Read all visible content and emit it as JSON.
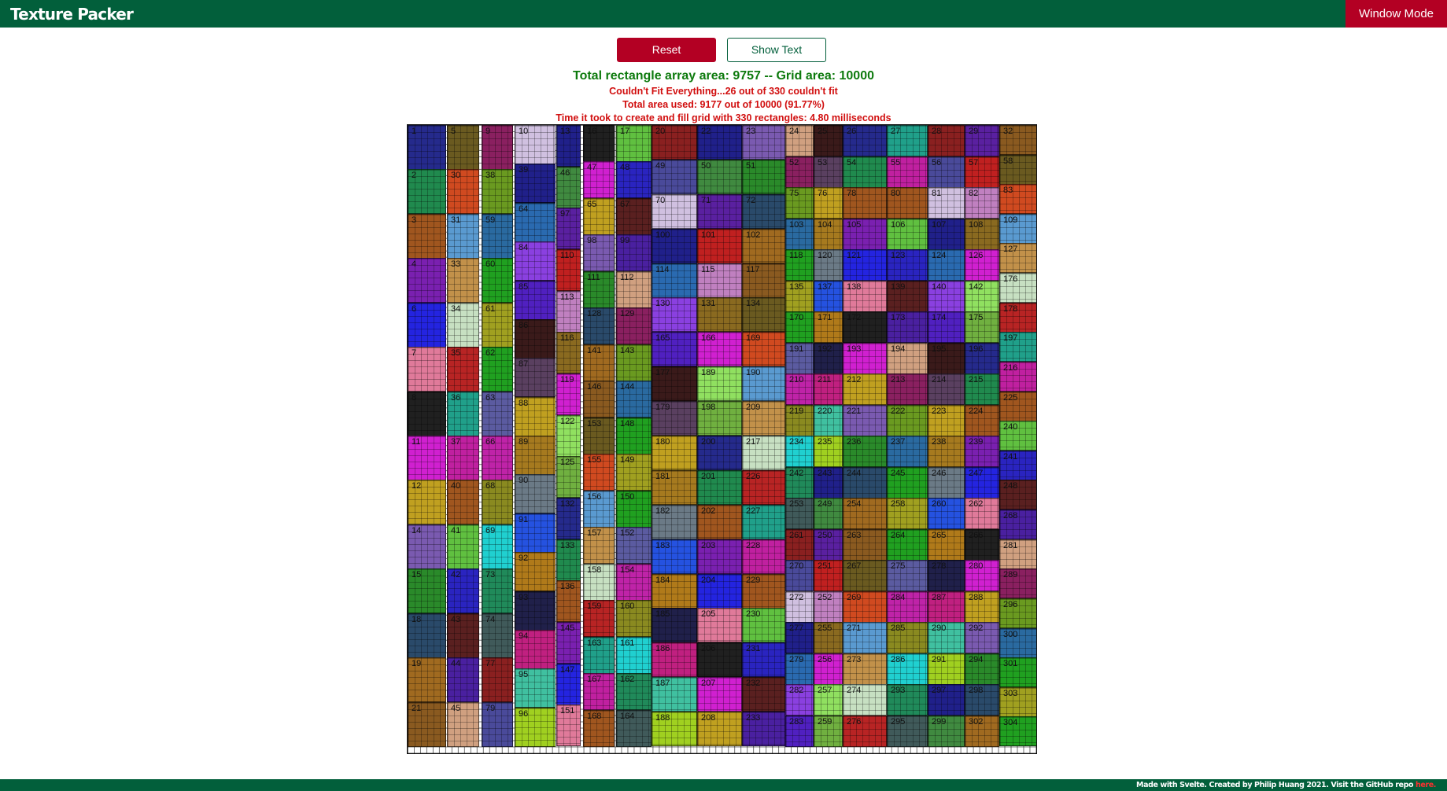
{
  "header": {
    "title": "Texture Packer",
    "window_mode_label": "Window Mode"
  },
  "controls": {
    "reset_label": "Reset",
    "show_text_label": "Show Text"
  },
  "stats": {
    "area_line": "Total rectangle array area: 9757 -- Grid area: 10000",
    "fit_line": "Couldn't Fit Everything...26 out of 330 couldn't fit",
    "used_line": "Total area used: 9177 out of 10000 (91.77%)",
    "time_line": "Time it took to create and fill grid with 330 rectangles: 4.80 milliseconds"
  },
  "grid_columns": [
    [
      "1",
      "2",
      "3",
      "4",
      "6",
      "7",
      "8",
      "11",
      "12",
      "14",
      "15",
      "18",
      "19",
      "21"
    ],
    [
      "5",
      "30",
      "31",
      "33",
      "34",
      "35",
      "36",
      "37",
      "40",
      "41",
      "42",
      "43",
      "44",
      "45"
    ],
    [
      "9",
      "38",
      "59",
      "60",
      "61",
      "62",
      "63",
      "66",
      "68",
      "69",
      "73",
      "74",
      "77",
      "79"
    ],
    [
      "10",
      "39",
      "64",
      "84",
      "85",
      "86",
      "87",
      "88",
      "89",
      "90",
      "91",
      "92",
      "93",
      "94",
      "95",
      "96"
    ],
    [
      "13",
      "46",
      "97",
      "110",
      "113",
      "116",
      "119",
      "122",
      "125",
      "132",
      "133",
      "136",
      "145",
      "147",
      "151"
    ],
    [
      "16",
      "47",
      "65",
      "98",
      "111",
      "128",
      "141",
      "146",
      "153",
      "155",
      "156",
      "157",
      "158",
      "159",
      "163",
      "167",
      "168"
    ],
    [
      "17",
      "48",
      "67",
      "99",
      "112",
      "129",
      "143",
      "144",
      "148",
      "149",
      "150",
      "152",
      "154",
      "160",
      "161",
      "162",
      "164"
    ],
    [
      "20",
      "49",
      "70",
      "100",
      "114",
      "130",
      "165",
      "177",
      "179",
      "180",
      "181",
      "182",
      "183",
      "184",
      "185",
      "186",
      "187",
      "188"
    ],
    [
      "22",
      "50",
      "71",
      "101",
      "115",
      "131",
      "166",
      "189",
      "198",
      "200",
      "201",
      "202",
      "203",
      "204",
      "205",
      "206",
      "207",
      "208"
    ],
    [
      "23",
      "51",
      "72",
      "102",
      "117",
      "134",
      "169",
      "190",
      "209",
      "217",
      "226",
      "227",
      "228",
      "229",
      "230",
      "231",
      "232",
      "233"
    ],
    [
      "24",
      "52",
      "75",
      "103",
      "118",
      "135",
      "170",
      "191",
      "210",
      "219",
      "234",
      "242",
      "253",
      "261",
      "270",
      "272",
      "277",
      "279",
      "282",
      "283"
    ],
    [
      "25",
      "53",
      "76",
      "104",
      "120",
      "137",
      "171",
      "192",
      "211",
      "220",
      "235",
      "243",
      "249",
      "250",
      "251",
      "252",
      "255",
      "256",
      "257",
      "259"
    ],
    [
      "26",
      "54",
      "78",
      "105",
      "121",
      "138",
      "172",
      "193",
      "212",
      "221",
      "236",
      "244",
      "254",
      "263",
      "267",
      "269",
      "271",
      "273",
      "274",
      "276"
    ],
    [
      "27",
      "55",
      "80",
      "106",
      "123",
      "139",
      "173",
      "194",
      "213",
      "222",
      "237",
      "245",
      "258",
      "264",
      "275",
      "284",
      "285",
      "286",
      "293",
      "295"
    ],
    [
      "28",
      "56",
      "81",
      "107",
      "124",
      "140",
      "174",
      "195",
      "214",
      "223",
      "238",
      "246",
      "260",
      "265",
      "278",
      "287",
      "290",
      "291",
      "297",
      "299"
    ],
    [
      "29",
      "57",
      "82",
      "108",
      "126",
      "142",
      "175",
      "196",
      "215",
      "224",
      "239",
      "247",
      "262",
      "266",
      "280",
      "288",
      "292",
      "294",
      "298",
      "302"
    ],
    [
      "32",
      "58",
      "83",
      "109",
      "127",
      "176",
      "178",
      "197",
      "216",
      "225",
      "240",
      "241",
      "248",
      "268",
      "281",
      "289",
      "296",
      "300",
      "301",
      "303",
      "304"
    ]
  ],
  "palette": [
    "#252a8c",
    "#c2914a",
    "#5b5ba0",
    "#a67a1f",
    "#1fcf5c",
    "#e01fb4",
    "#707327",
    "#d65a1f",
    "#9a8fbf",
    "#8a2060",
    "#ea2424",
    "#2f5f2f",
    "#5c1f1f",
    "#2f8a2f",
    "#208a4e",
    "#c7e0c2",
    "#bf23a8",
    "#6b7a86",
    "#9a5a7a",
    "#8a8ad6",
    "#25c725",
    "#d11f4f",
    "#7a9a3f",
    "#9a2020",
    "#2a24c0",
    "#20c78a",
    "#c0907a",
    "#6a9a9a",
    "#a0561f",
    "#b82424",
    "#8a8a20",
    "#2552e0",
    "#3a6a8a",
    "#208a9a",
    "#d9764a",
    "#7a9a20",
    "#a06a7a",
    "#50c7a0",
    "#e02424",
    "#7a8a9a",
    "#8a8ad6",
    "#3a3a1f",
    "#7a20b0",
    "#20a08a",
    "#20d0d0",
    "#b07a1a",
    "#20208a",
    "#a0d020",
    "#20208a",
    "#1a1a1a",
    "#5a1f1f",
    "#1f3f1f",
    "#2020e0",
    "#e02020",
    "#7a20c0",
    "#2020a0",
    "#7a20a0",
    "#8a5a1f",
    "#2424e0",
    "#d020a0",
    "#20208a",
    "#5a208a",
    "#a08a20",
    "#20a020",
    "#a0c0a0",
    "#20a020",
    "#8a8a20",
    "#20a020",
    "#d0d020",
    "#20a020",
    "#a0a0a0",
    "#7a20c0",
    "#6a9ad0",
    "#e07a9a",
    "#8a5a1f",
    "#c0208a",
    "#b02020",
    "#2020e0",
    "#8a8a20",
    "#80a0a0",
    "#d0a080",
    "#8a5a1f",
    "#d02020",
    "#20c020",
    "#c02020",
    "#909090",
    "#20b050",
    "#902020",
    "#2020a0",
    "#202020",
    "#6a9a20",
    "#404040",
    "#20a080",
    "#9a2090",
    "#8a2040",
    "#20a020",
    "#20a020",
    "#d040a0",
    "#20c020",
    "#8a5a20",
    "#d020d0",
    "#c040a0",
    "#202060",
    "#602040",
    "#2a8a40",
    "#c08a20",
    "#d02020",
    "#d020d0",
    "#d020d0",
    "#202020",
    "#40c080",
    "#20a0e0",
    "#a0c020",
    "#20d060",
    "#20d0d0",
    "#20c060",
    "#202020",
    "#20a020",
    "#20a0c0",
    "#20c0a0",
    "#8a20a0",
    "#20a020",
    "#2020c0",
    "#20c060",
    "#20c060"
  ],
  "color_cycle": [
    "#252a8c",
    "#208a4e",
    "#a0561f",
    "#7a20b0",
    "#2424e0",
    "#e07a9a",
    "#202020",
    "#d020d0",
    "#c0a020",
    "#7a5ab0",
    "#2a8a2a",
    "#2a4a6a",
    "#a06a20",
    "#8a5a20",
    "#6a5a20",
    "#d04a20",
    "#5a9ad0",
    "#c2914a",
    "#c7e0c2",
    "#b82424",
    "#20a08a",
    "#c020a0",
    "#a0561f",
    "#60c040",
    "#2a24c0",
    "#5a2020",
    "#4a20a0",
    "#d0a080",
    "#8a2060",
    "#6a9a20",
    "#2a6aa0",
    "#20a020",
    "#a0a020",
    "#20a020",
    "#5b5ba0",
    "#bf23a8",
    "#8a8a20",
    "#20d0d0",
    "#208a5a",
    "#405a5a",
    "#8a2020",
    "#4a4a9a",
    "#d0c0e0",
    "#20208a",
    "#2a6ab0",
    "#8a40e0",
    "#5020c0",
    "#3a1a1a",
    "#5a4060",
    "#c0a020",
    "#a67a1f",
    "#6b7a86",
    "#2552e0",
    "#b07a1a",
    "#20204a",
    "#c02080",
    "#40c0a0",
    "#a0d020",
    "#20208a",
    "#408a40",
    "#5a20a0",
    "#c02020",
    "#c080c0",
    "#8a6a20",
    "#d020d0",
    "#90e060",
    "#70b040"
  ],
  "footer": {
    "text": "Made with Svelte. Created by Philip Huang 2021. Visit the GitHub repo",
    "link_label": "here."
  }
}
